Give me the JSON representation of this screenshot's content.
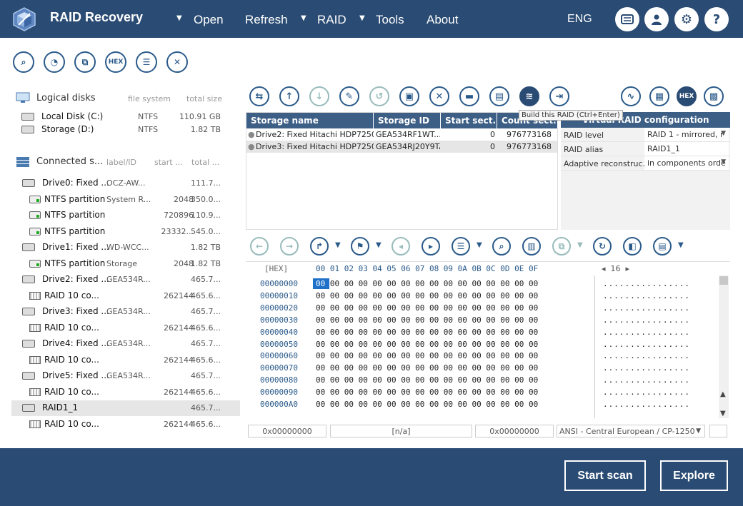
{
  "app": {
    "title": "RAID Recovery"
  },
  "menu": {
    "open": "Open",
    "refresh": "Refresh",
    "raid": "RAID",
    "tools": "Tools",
    "about": "About",
    "lang": "ENG"
  },
  "left_toolbar": {
    "hex": "HEX"
  },
  "logical": {
    "header": "Logical disks",
    "col_fs": "file system",
    "col_size": "total size",
    "items": [
      {
        "name": "Local Disk (C:)",
        "fs": "NTFS",
        "size": "110.91 GB"
      },
      {
        "name": "Storage (D:)",
        "fs": "NTFS",
        "size": "1.82 TB"
      }
    ]
  },
  "connected": {
    "header": "Connected s...",
    "col_label": "label/ID",
    "col_start": "start ...",
    "col_total": "total ...",
    "items": [
      {
        "kind": "disk",
        "name": "Drive0: Fixed ...",
        "label": "OCZ-AW...",
        "start": "",
        "size": "111.7..."
      },
      {
        "kind": "part",
        "name": "NTFS partition",
        "label": "System R...",
        "start": "2048",
        "size": "350.0..."
      },
      {
        "kind": "part",
        "name": "NTFS partition",
        "label": "",
        "start": "720896",
        "size": "110.9..."
      },
      {
        "kind": "part",
        "name": "NTFS partition",
        "label": "",
        "start": "23332...",
        "size": "545.0..."
      },
      {
        "kind": "disk",
        "name": "Drive1: Fixed ...",
        "label": "WD-WCC...",
        "start": "",
        "size": "1.82 TB"
      },
      {
        "kind": "part",
        "name": "NTFS partition",
        "label": "Storage",
        "start": "2048",
        "size": "1.82 TB"
      },
      {
        "kind": "disk",
        "name": "Drive2: Fixed ...",
        "label": "GEA534R...",
        "start": "",
        "size": "465.7..."
      },
      {
        "kind": "raid",
        "name": "RAID 10 co...",
        "label": "",
        "start": "262144",
        "size": "465.6..."
      },
      {
        "kind": "disk",
        "name": "Drive3: Fixed ...",
        "label": "GEA534R...",
        "start": "",
        "size": "465.7..."
      },
      {
        "kind": "raid",
        "name": "RAID 10 co...",
        "label": "",
        "start": "262144",
        "size": "465.6..."
      },
      {
        "kind": "disk",
        "name": "Drive4: Fixed ...",
        "label": "GEA534R...",
        "start": "",
        "size": "465.7..."
      },
      {
        "kind": "raid",
        "name": "RAID 10 co...",
        "label": "",
        "start": "262144",
        "size": "465.6..."
      },
      {
        "kind": "disk",
        "name": "Drive5: Fixed ...",
        "label": "GEA534R...",
        "start": "",
        "size": "465.7..."
      },
      {
        "kind": "raid",
        "name": "RAID 10 co...",
        "label": "",
        "start": "262144",
        "size": "465.6..."
      },
      {
        "kind": "raidvol",
        "name": "RAID1_1",
        "label": "",
        "start": "",
        "size": "465.7..."
      },
      {
        "kind": "raid",
        "name": "RAID 10 co...",
        "label": "",
        "start": "262144",
        "size": "465.6..."
      }
    ]
  },
  "tooltip": "Build this RAID (Ctrl+Enter)",
  "storage_table": {
    "headers": [
      "Storage name",
      "Storage ID",
      "Start sect...",
      "Count sect..."
    ],
    "rows": [
      {
        "name": "Drive2: Fixed Hitachi HDP7250...",
        "id": "GEA534RF1WT...",
        "start": "0",
        "count": "976773168"
      },
      {
        "name": "Drive3: Fixed Hitachi HDP7250...",
        "id": "GEA534RJ20Y9TA",
        "start": "0",
        "count": "976773168"
      }
    ]
  },
  "raid_config": {
    "header": "Virtual RAID configuration",
    "rows": [
      {
        "key": "RAID level",
        "value": "RAID 1 - mirrored, r",
        "dropdown": true
      },
      {
        "key": "RAID alias",
        "value": "RAID1_1",
        "dropdown": false
      },
      {
        "key": "Adaptive reconstruc...",
        "value": "in components orde",
        "dropdown": true
      }
    ]
  },
  "hex": {
    "label": "[HEX]",
    "columns": "00 01 02 03 04 05 06 07 08 09 0A 0B 0C 0D 0E 0F",
    "width_label": "16",
    "selected_byte": "00",
    "offsets": [
      "00000000",
      "00000010",
      "00000020",
      "00000030",
      "00000040",
      "00000050",
      "00000060",
      "00000070",
      "00000080",
      "00000090",
      "000000A0"
    ],
    "row_bytes": "00 00 00 00 00 00 00 00 00 00 00 00 00 00 00 00",
    "row_ascii": "................"
  },
  "status": {
    "offset": "0x00000000",
    "value": "[n/a]",
    "offset2": "0x00000000",
    "encoding": "ANSI - Central European / CP-1250"
  },
  "actions": {
    "start_scan": "Start scan",
    "explore": "Explore"
  }
}
